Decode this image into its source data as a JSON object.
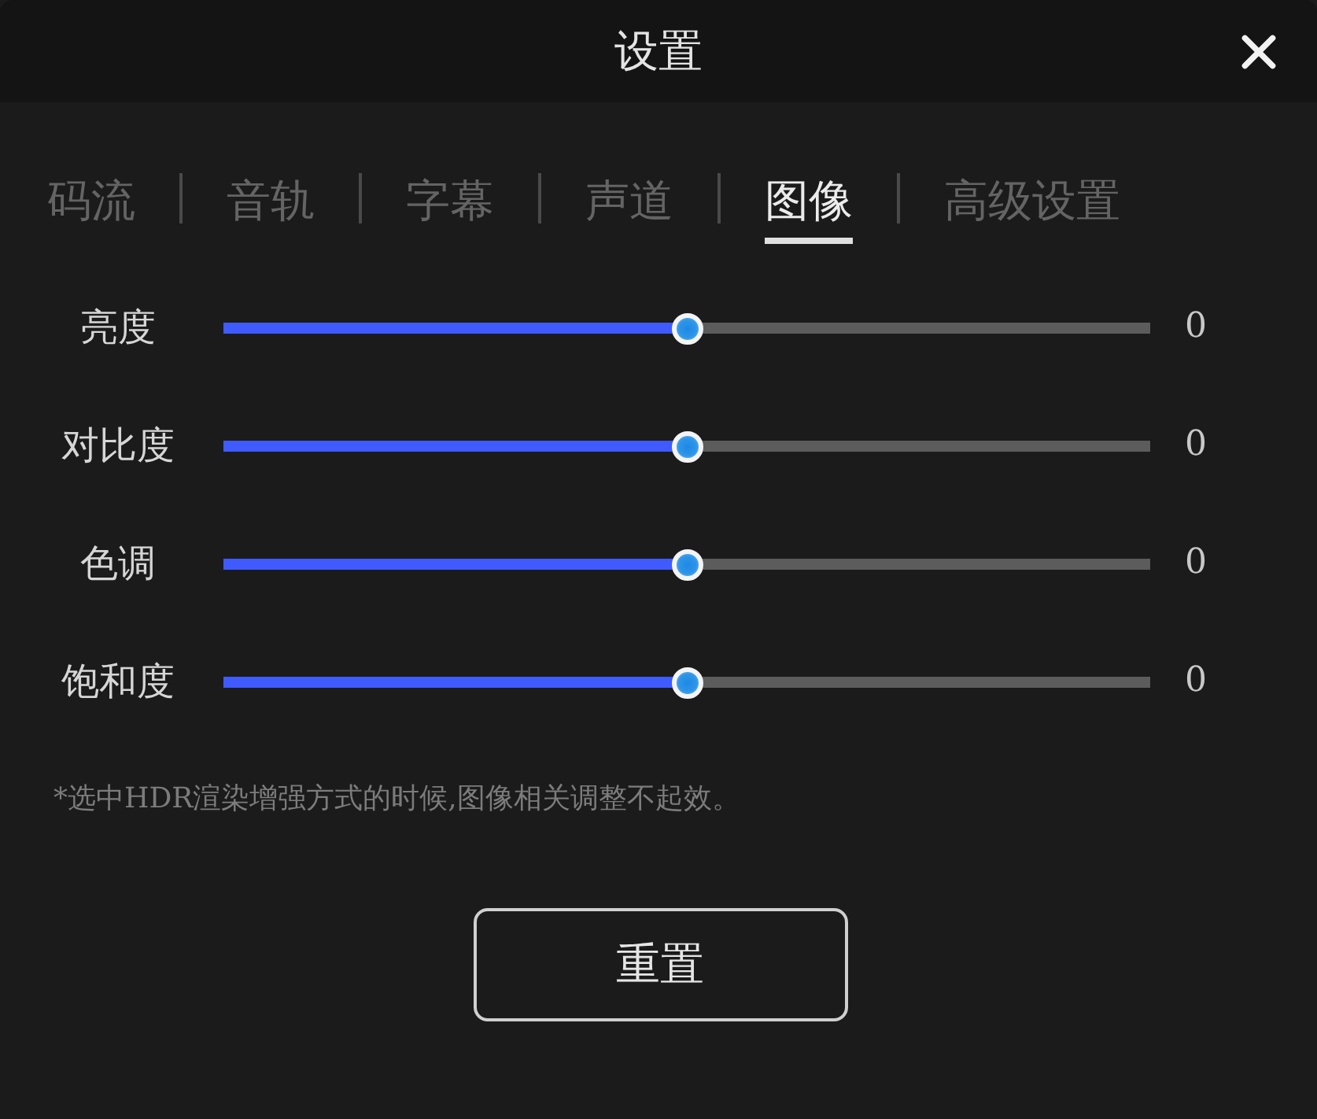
{
  "window": {
    "title": "设置"
  },
  "tabs": [
    {
      "label": "码流",
      "selected": false
    },
    {
      "label": "音轨",
      "selected": false
    },
    {
      "label": "字幕",
      "selected": false
    },
    {
      "label": "声道",
      "selected": false
    },
    {
      "label": "图像",
      "selected": true
    },
    {
      "label": "高级设置",
      "selected": false
    }
  ],
  "sliders": [
    {
      "label": "亮度",
      "level": 0.5,
      "reading": "0"
    },
    {
      "label": "对比度",
      "level": 0.5,
      "reading": "0"
    },
    {
      "label": "色调",
      "level": 0.5,
      "reading": "0"
    },
    {
      "label": "饱和度",
      "level": 0.5,
      "reading": "0"
    }
  ],
  "note": "*选中HDR渲染增强方式的时候,图像相关调整不起效。",
  "reset_button": "重置"
}
